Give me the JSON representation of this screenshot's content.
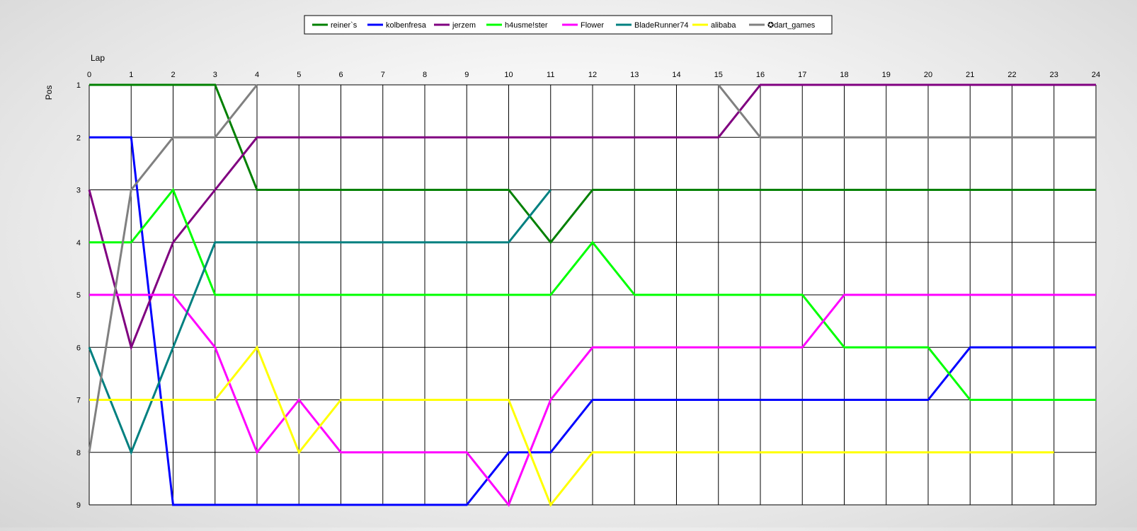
{
  "chart_data": {
    "type": "line",
    "title": "",
    "xlabel": "Lap",
    "ylabel": "Pos",
    "x": [
      0,
      1,
      2,
      3,
      4,
      5,
      6,
      7,
      8,
      9,
      10,
      11,
      12,
      13,
      14,
      15,
      16,
      17,
      18,
      19,
      20,
      21,
      22,
      23,
      24
    ],
    "xlim": [
      0,
      24
    ],
    "ylim": [
      1,
      9
    ],
    "y_inverted": true,
    "x_axis_position": "top",
    "yticks": [
      1,
      2,
      3,
      4,
      5,
      6,
      7,
      8,
      9
    ],
    "grid": true,
    "legend_position": "top-center",
    "series": [
      {
        "name": "reiner`s",
        "color": "#008000",
        "values": [
          1,
          1,
          1,
          1,
          3,
          3,
          3,
          3,
          3,
          3,
          3,
          4,
          3,
          3,
          3,
          3,
          3,
          3,
          3,
          3,
          3,
          3,
          3,
          3,
          3
        ]
      },
      {
        "name": "kolbenfresa",
        "color": "#0000ff",
        "values": [
          2,
          2,
          9,
          9,
          9,
          9,
          9,
          9,
          9,
          9,
          8,
          8,
          7,
          7,
          7,
          7,
          7,
          7,
          7,
          7,
          7,
          6,
          6,
          6,
          6
        ]
      },
      {
        "name": "jerzem",
        "color": "#800080",
        "values": [
          3,
          6,
          4,
          3,
          2,
          2,
          2,
          2,
          2,
          2,
          2,
          2,
          2,
          2,
          2,
          2,
          1,
          1,
          1,
          1,
          1,
          1,
          1,
          1,
          1
        ]
      },
      {
        "name": "h4usme!ster",
        "color": "#00ff00",
        "values": [
          4,
          4,
          3,
          5,
          5,
          5,
          5,
          5,
          5,
          5,
          5,
          5,
          4,
          5,
          5,
          5,
          5,
          5,
          6,
          6,
          6,
          7,
          7,
          7,
          7
        ]
      },
      {
        "name": "Flower",
        "color": "#ff00ff",
        "values": [
          5,
          5,
          5,
          6,
          8,
          7,
          8,
          8,
          8,
          8,
          9,
          7,
          6,
          6,
          6,
          6,
          6,
          6,
          5,
          5,
          5,
          5,
          5,
          5,
          5
        ]
      },
      {
        "name": "BladeRunner74",
        "color": "#008080",
        "values": [
          6,
          8,
          6,
          4,
          4,
          4,
          4,
          4,
          4,
          4,
          4,
          3
        ]
      },
      {
        "name": "alibaba",
        "color": "#ffff00",
        "values": [
          7,
          7,
          7,
          7,
          6,
          8,
          7,
          7,
          7,
          7,
          7,
          9,
          8,
          8,
          8,
          8,
          8,
          8,
          8,
          8,
          8,
          8,
          8,
          8
        ]
      },
      {
        "name": "✪dart_games",
        "color": "#808080",
        "values": [
          8,
          3,
          2,
          2,
          1,
          null,
          null,
          null,
          null,
          null,
          null,
          null,
          null,
          null,
          null,
          1,
          2,
          2,
          2,
          2,
          2,
          2,
          2,
          2,
          2
        ]
      }
    ]
  }
}
